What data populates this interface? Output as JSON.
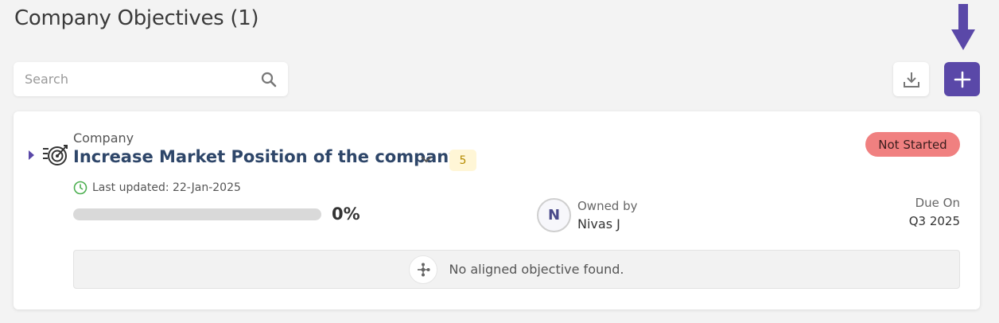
{
  "header": {
    "title": "Company Objectives (1)"
  },
  "toolbar": {
    "search_placeholder": "Search",
    "search_value": "",
    "search_icon": "search-icon",
    "download_icon": "download-icon",
    "add_icon": "plus-icon",
    "accent_color": "#5a48a8",
    "annotation_arrow_color": "#5a48a8"
  },
  "objective": {
    "type_label": "Company",
    "title": "Increase Market Position of the company",
    "count": "5",
    "status": "Not Started",
    "status_color": "#f08080",
    "last_updated": "Last updated: 22-Jan-2025",
    "progress_percent": 0,
    "progress_label": "0%",
    "owner_initial": "N",
    "owned_by_label": "Owned by",
    "owner_name": "Nivas J",
    "due_label": "Due On",
    "due_value": "Q3 2025",
    "aligned_message": "No aligned objective found."
  }
}
